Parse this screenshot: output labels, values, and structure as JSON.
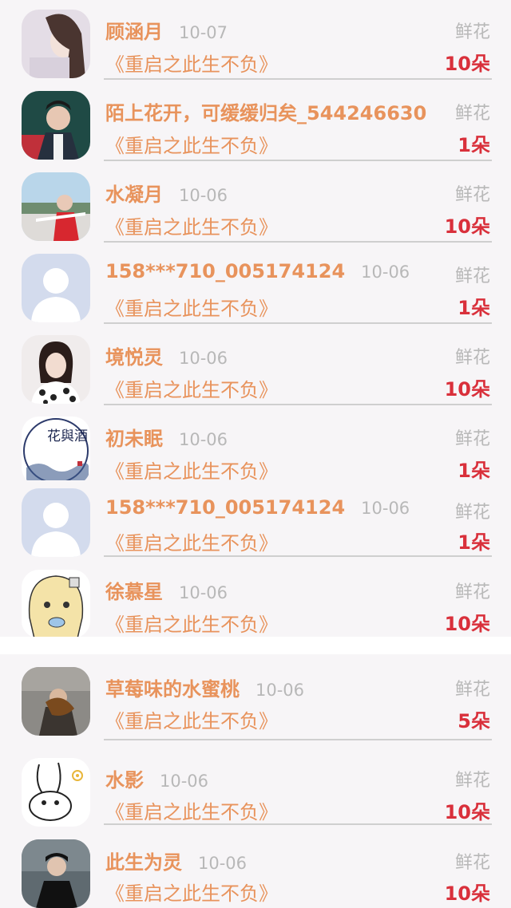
{
  "gift_label": "鲜花",
  "rows": [
    {
      "name": "顾涵月",
      "date": "10-07",
      "book": "《重启之此生不负》",
      "count": "10朵"
    },
    {
      "name": "陌上花开，可缓缓归矣_544246630",
      "date": "10-06",
      "book": "《重启之此生不负》",
      "count": "1朵"
    },
    {
      "name": "水凝月",
      "date": "10-06",
      "book": "《重启之此生不负》",
      "count": "10朵"
    },
    {
      "name": "158***710_005174124",
      "date": "10-06",
      "book": "《重启之此生不负》",
      "count": "1朵"
    },
    {
      "name": "境悦灵",
      "date": "10-06",
      "book": "《重启之此生不负》",
      "count": "10朵"
    },
    {
      "name": "初未眠",
      "date": "10-06",
      "book": "《重启之此生不负》",
      "count": "1朵"
    },
    {
      "name": "158***710_005174124",
      "date": "10-06",
      "book": "《重启之此生不负》",
      "count": "1朵"
    },
    {
      "name": "徐慕星",
      "date": "10-06",
      "book": "《重启之此生不负》",
      "count": "10朵"
    },
    {
      "name": "草莓味的水蜜桃",
      "date": "10-06",
      "book": "《重启之此生不负》",
      "count": "5朵"
    },
    {
      "name": "水影",
      "date": "10-06",
      "book": "《重启之此生不负》",
      "count": "10朵"
    },
    {
      "name": "此生为灵",
      "date": "10-06",
      "book": "《重启之此生不负》",
      "count": "10朵"
    }
  ],
  "avatar_seal_text": "花與酒",
  "colors": {
    "name": "#e8935c",
    "count": "#d9303b",
    "muted": "#b8b8b8"
  }
}
